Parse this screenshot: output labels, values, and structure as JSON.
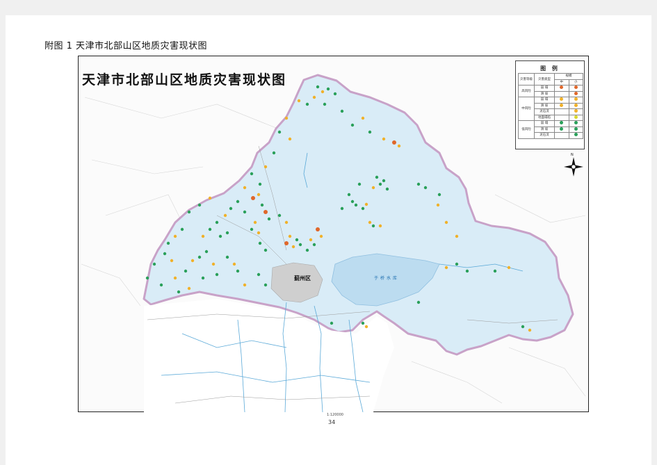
{
  "caption": "附图 1  天津市北部山区地质灾害现状图",
  "map": {
    "title": "天津市北部山区地质灾害现状图",
    "district_label": "蓟州区",
    "lake_label": "于桥水库",
    "compass_label": "N"
  },
  "legend": {
    "title": "图 例",
    "header": {
      "col1": "灾害等级",
      "col2": "灾害类型",
      "col3": "规模",
      "small": "小",
      "medium": "中"
    },
    "rows": [
      {
        "group": "高风险",
        "type": "崩 塌",
        "colors": [
          "#e0672a",
          "#e0672a"
        ]
      },
      {
        "group": "",
        "type": "滑 坡",
        "colors": [
          "",
          "#e0672a"
        ]
      },
      {
        "group": "中风险",
        "type": "崩 塌",
        "colors": [
          "#f0b12a",
          "#f0b12a"
        ]
      },
      {
        "group": "",
        "type": "滑 坡",
        "colors": [
          "#f0b12a",
          "#f0b12a"
        ]
      },
      {
        "group": "",
        "type": "泥石流",
        "colors": [
          "",
          "#f0b12a"
        ]
      },
      {
        "group": "",
        "type": "地面塌陷",
        "colors": [
          "",
          "#d8d82a"
        ]
      },
      {
        "group": "低风险",
        "type": "崩 塌",
        "colors": [
          "#2aa05a",
          "#2aa05a"
        ]
      },
      {
        "group": "",
        "type": "滑 坡",
        "colors": [
          "#2aa05a",
          "#2aa05a"
        ]
      },
      {
        "group": "",
        "type": "泥石流",
        "colors": [
          "",
          "#2aa05a"
        ]
      }
    ]
  },
  "scale": "1:120000",
  "page_number": "34",
  "colors": {
    "region_fill": "#d9ecf7",
    "region_border": "#c8a2c8",
    "lake": "#bcdcf0",
    "high_risk": "#e0672a",
    "medium_risk": "#f0b12a",
    "low_risk": "#2aa05a"
  }
}
